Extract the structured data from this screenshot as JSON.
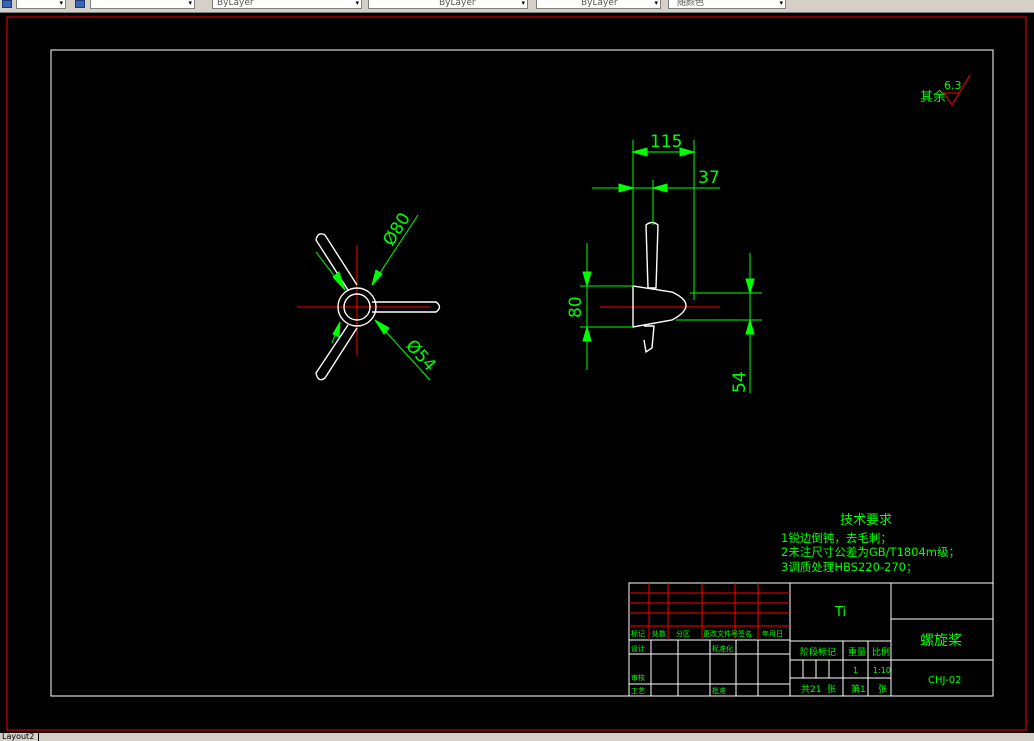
{
  "toolbar": {
    "combo_1": "",
    "combo_2": "",
    "layer_combo": "ByLayer",
    "linetype_combo": "ByLayer",
    "lineweight_combo": "ByLayer",
    "plotstyle_combo": "随颜色"
  },
  "tabs": {
    "layout": "Layout2"
  },
  "drawing": {
    "front_view": {
      "dim_outer": "Ø80",
      "dim_inner": "Ø54"
    },
    "side_view": {
      "dim_top": "115",
      "dim_offset": "37",
      "dim_left": "80",
      "dim_right": "54"
    },
    "roughness": {
      "label": "其余",
      "value": "6.3"
    },
    "tech_requirements": {
      "title": "技术要求",
      "lines": [
        "1锐边倒钝，去毛刺；",
        "2未注尺寸公差为GB/T1804m级；",
        "3调质处理HBS220-270；"
      ]
    },
    "title_block": {
      "material": "Ti",
      "part_name": "螺旋桨",
      "drawing_no": "CHJ-02",
      "stage_mark": "阶段标记",
      "weight": "重量",
      "scale": "比例",
      "qty": "1",
      "scale_value": "1:10",
      "sheets_total": "共21",
      "sheets_unit": "张",
      "sheet_no": "第1",
      "sheet_unit": "张",
      "rev_headers": [
        "标记",
        "处数",
        "分区",
        "更改文件号",
        "签名",
        "年月日"
      ],
      "design": "设计",
      "standardize": "标准化",
      "review": "审核",
      "process": "工艺",
      "approve": "批准"
    }
  }
}
